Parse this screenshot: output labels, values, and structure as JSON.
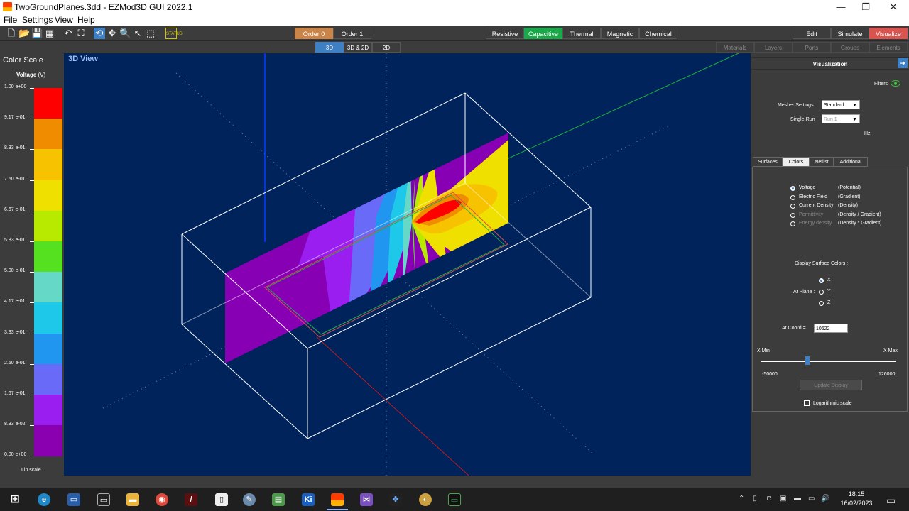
{
  "window": {
    "title": "TwoGroundPlanes.3dd - EZMod3D GUI 2022.1",
    "controls": [
      "—",
      "❐",
      "✕"
    ]
  },
  "menu": [
    "File",
    "Settings",
    "View",
    "Help"
  ],
  "toolbar": {
    "order_tabs": [
      "Order 0",
      "Order 1"
    ],
    "physics_tabs": [
      "Resistive",
      "Capacitive",
      "Thermal",
      "Magnetic",
      "Chemical"
    ],
    "mode_tabs": [
      "Edit",
      "Simulate",
      "Visualize"
    ],
    "status_label": "STATUS"
  },
  "view_tabs": [
    "3D",
    "3D & 2D",
    "2D"
  ],
  "right_tabs": [
    "Materials",
    "Layers",
    "Ports",
    "Groups",
    "Elements"
  ],
  "color_scale": {
    "title": "Color Scale",
    "quantity": "Voltage",
    "unit": "(V)",
    "ticks": [
      "1.00 e+00",
      "9.17 e-01",
      "8.33 e-01",
      "7.50 e-01",
      "6.67 e-01",
      "5.83 e-01",
      "5.00 e-01",
      "4.17 e-01",
      "3.33 e-01",
      "2.50 e-01",
      "1.67 e-01",
      "8.33 e-02",
      "0.00 e+00"
    ],
    "colors": [
      "#ff0000",
      "#f08c00",
      "#f7c300",
      "#f0e000",
      "#b8ea00",
      "#55e020",
      "#66d8c8",
      "#1ec8e8",
      "#2196f0",
      "#6a6af8",
      "#9b1ef0",
      "#8a00b0"
    ],
    "scale_label": "Lin scale"
  },
  "view3d": {
    "title": "3D View"
  },
  "visualization": {
    "header": "Visualization",
    "filters_label": "Filters",
    "mesher_label": "Mesher Settings :",
    "mesher_value": "Standard",
    "singlerun_label": "Single-Run :",
    "singlerun_value": "Run 1",
    "hz_label": "Hz",
    "tabs": [
      "Surfaces",
      "Colors",
      "Netlist",
      "Additional"
    ],
    "options": [
      {
        "name": "Voltage",
        "desc": "(Potential)",
        "selected": true,
        "dim": false
      },
      {
        "name": "Electric Field",
        "desc": "(Gradient)",
        "selected": false,
        "dim": false
      },
      {
        "name": "Current Density",
        "desc": "(Density)",
        "selected": false,
        "dim": false
      },
      {
        "name": "Permittivity",
        "desc": "(Density / Gradient)",
        "selected": false,
        "dim": true
      },
      {
        "name": "Energy density",
        "desc": "(Density * Gradient)",
        "selected": false,
        "dim": true
      }
    ],
    "display_surface_label": "Display Surface Colors :",
    "at_plane_label": "At Plane :",
    "planes": [
      "X",
      "Y",
      "Z"
    ],
    "plane_selected": "X",
    "at_coord_label": "At Coord =",
    "at_coord_value": "10622",
    "xmin_label": "X Min",
    "xmax_label": "X Max",
    "xmin_value": "-50000",
    "xmax_value": "126000",
    "slider_fraction": 0.34,
    "update_label": "Update Display",
    "log_label": "Logarithmic scale"
  },
  "taskbar": {
    "time": "18:15",
    "date": "16/02/2023"
  }
}
